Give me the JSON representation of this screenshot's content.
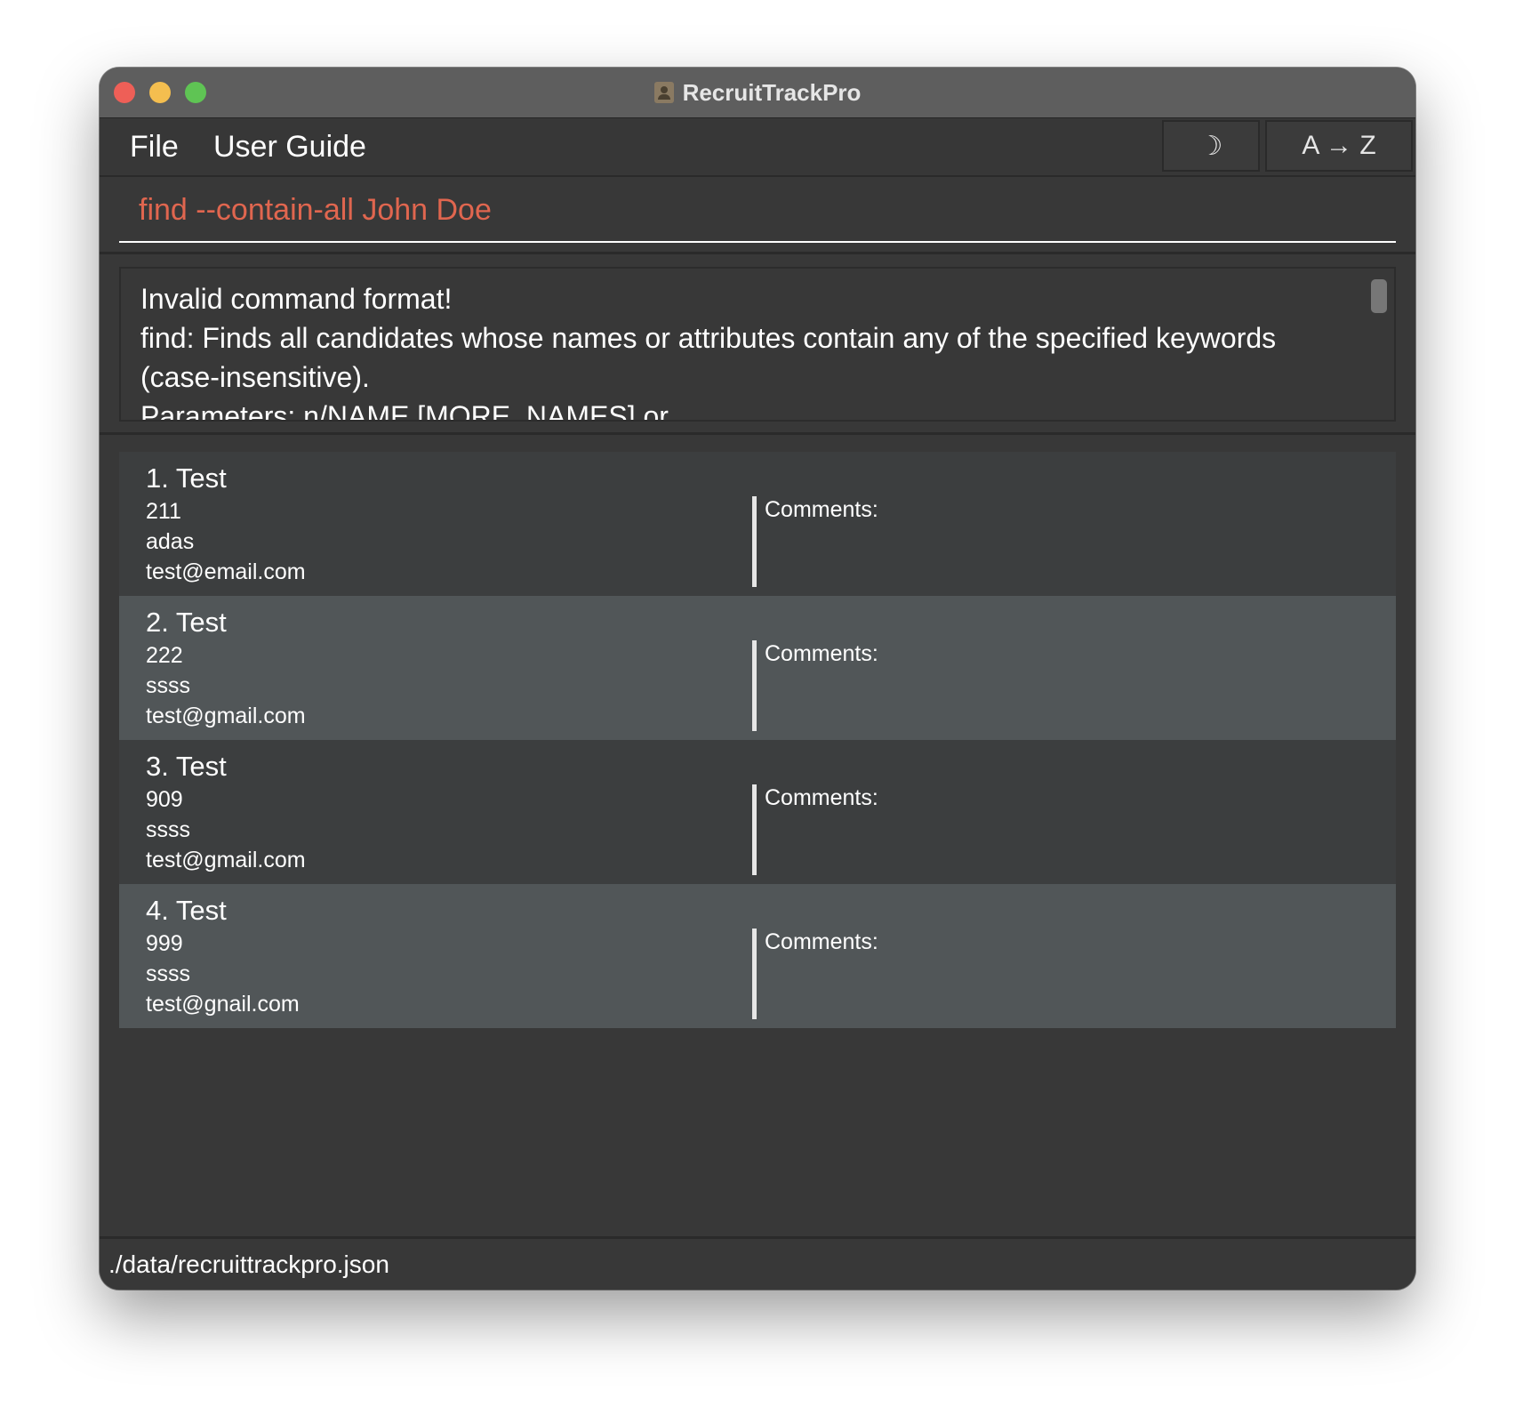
{
  "window": {
    "title": "RecruitTrackPro",
    "app_icon": "contacts-book-icon"
  },
  "menu": {
    "file_label": "File",
    "user_guide_label": "User Guide"
  },
  "toolbar": {
    "theme_toggle_label": "☽",
    "theme_toggle_icon": "moon-icon",
    "sort_label": "A → Z"
  },
  "command": {
    "value": "find --contain-all John Doe",
    "value_color": "#e0664f"
  },
  "result": {
    "text": "Invalid command format!\nfind: Finds all candidates whose names or attributes contain any of the specified keywords (case-insensitive).\nParameters: n/NAME [MORE_NAMES] or"
  },
  "candidates": [
    {
      "name": "1. Test",
      "phone": "211",
      "address": "adas",
      "email": "test@email.com",
      "comments_label": "Comments:"
    },
    {
      "name": "2. Test",
      "phone": "222",
      "address": "ssss",
      "email": "test@gmail.com",
      "comments_label": "Comments:"
    },
    {
      "name": "3. Test",
      "phone": "909",
      "address": "ssss",
      "email": "test@gmail.com",
      "comments_label": "Comments:"
    },
    {
      "name": "4. Test",
      "phone": "999",
      "address": "ssss",
      "email": "test@gnail.com",
      "comments_label": "Comments:"
    }
  ],
  "status": {
    "path": "./data/recruittrackpro.json"
  }
}
